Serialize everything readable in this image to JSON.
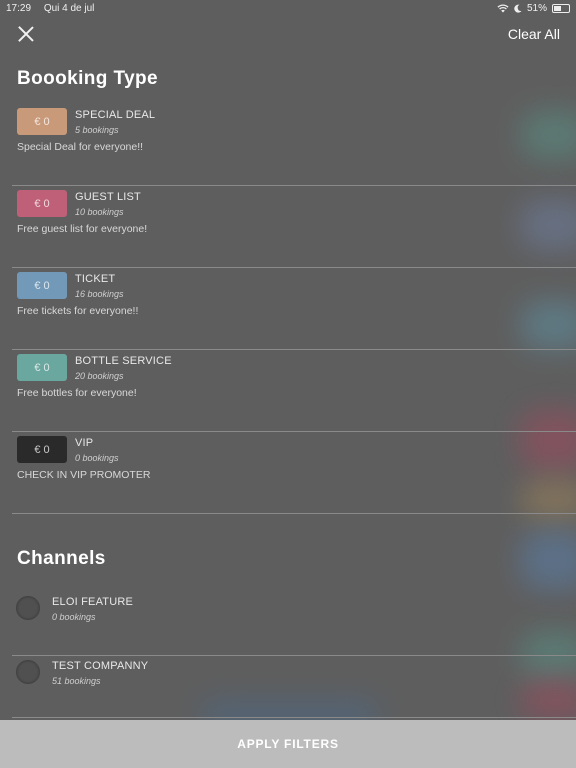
{
  "status_bar": {
    "time": "17:29",
    "date": "Qui 4 de jul",
    "battery_percent": "51%",
    "battery_level": 0.51
  },
  "header": {
    "close_icon": "close-icon",
    "clear_all_label": "Clear All"
  },
  "booking_type": {
    "title": "Boooking Type",
    "items": [
      {
        "price": "€ 0",
        "name": "SPECIAL DEAL",
        "count": "5 bookings",
        "description": "Special Deal for everyone!!",
        "color": "#c99a7a"
      },
      {
        "price": "€ 0",
        "name": "GUEST LIST",
        "count": "10 bookings",
        "description": "Free guest list for everyone!",
        "color": "#c06078"
      },
      {
        "price": "€ 0",
        "name": "TICKET",
        "count": "16 bookings",
        "description": "Free tickets for everyone!!",
        "color": "#7399b8"
      },
      {
        "price": "€ 0",
        "name": "BOTTLE SERVICE",
        "count": "20 bookings",
        "description": "Free bottles for everyone!",
        "color": "#6aa79e"
      },
      {
        "price": "€ 0",
        "name": "VIP",
        "count": "0 bookings",
        "description": "CHECK IN VIP PROMOTER",
        "color": "#2a2a2a"
      }
    ]
  },
  "channels": {
    "title": "Channels",
    "items": [
      {
        "name": "ELOI FEATURE",
        "count": "0 bookings"
      },
      {
        "name": "TEST COMPANNY",
        "count": "51 bookings"
      }
    ]
  },
  "footer": {
    "apply_label": "APPLY FILTERS"
  }
}
